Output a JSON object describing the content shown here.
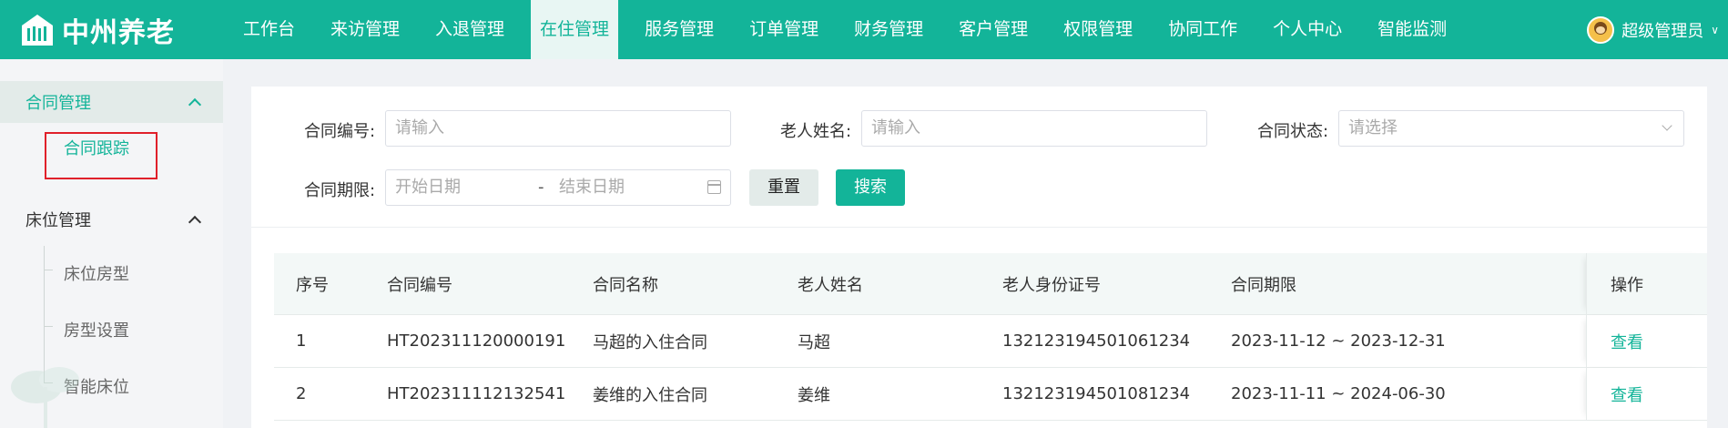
{
  "brand": {
    "name": "中州养老",
    "logo_icon": "piano-house-icon"
  },
  "nav": {
    "items": [
      "工作台",
      "来访管理",
      "入退管理",
      "在住管理",
      "服务管理",
      "订单管理",
      "财务管理",
      "客户管理",
      "权限管理",
      "协同工作",
      "个人中心",
      "智能监测"
    ],
    "active": "在住管理"
  },
  "user": {
    "name": "超级管理员",
    "caret_icon": "chevron-down-icon"
  },
  "sidebar": {
    "group1": {
      "label": "合同管理",
      "items": [
        "合同跟踪"
      ]
    },
    "group2": {
      "label": "床位管理",
      "items": [
        "床位房型",
        "房型设置",
        "智能床位"
      ]
    }
  },
  "filter": {
    "contract_no_label": "合同编号:",
    "contract_no_placeholder": "请输入",
    "elder_name_label": "老人姓名:",
    "elder_name_placeholder": "请输入",
    "status_label": "合同状态:",
    "status_placeholder": "请选择",
    "period_label": "合同期限:",
    "start_placeholder": "开始日期",
    "separator": "-",
    "end_placeholder": "结束日期",
    "reset_label": "重置",
    "search_label": "搜索"
  },
  "table": {
    "headers": [
      "序号",
      "合同编号",
      "合同名称",
      "老人姓名",
      "老人身份证号",
      "合同期限",
      "操作"
    ],
    "rows": [
      [
        "1",
        "HT202311120000191",
        "马超的入住合同",
        "马超",
        "132123194501061234",
        "2023-11-12 ~ 2023-12-31",
        "查看"
      ],
      [
        "2",
        "HT202311112132541",
        "姜维的入住合同",
        "姜维",
        "132123194501081234",
        "2023-11-11 ~ 2024-06-30",
        "查看"
      ]
    ]
  },
  "colors": {
    "accent": "#13b499",
    "highlight": "#e0202a"
  }
}
